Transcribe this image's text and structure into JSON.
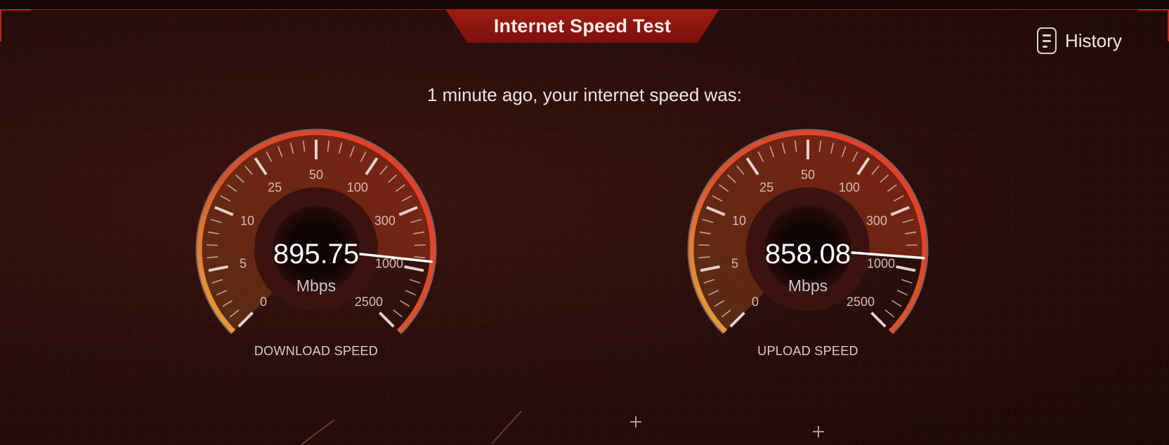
{
  "header": {
    "title": "Internet Speed Test"
  },
  "history": {
    "label": "History",
    "icon": "document-list-icon"
  },
  "summary": {
    "text": "1 minute ago, your internet speed was:"
  },
  "gauges": [
    {
      "id": "download",
      "value": "895.75",
      "unit": "Mbps",
      "caption": "DOWNLOAD SPEED",
      "reading_mbps": 895.75
    },
    {
      "id": "upload",
      "value": "858.08",
      "unit": "Mbps",
      "caption": "UPLOAD SPEED",
      "reading_mbps": 858.08
    }
  ],
  "scale_labels": [
    "0",
    "5",
    "10",
    "25",
    "50",
    "100",
    "300",
    "1000",
    "2500"
  ],
  "colors": {
    "accent": "#c0241a",
    "gauge_low": "#e8a53a",
    "gauge_high": "#e8362a",
    "background": "#2a0e0b"
  }
}
